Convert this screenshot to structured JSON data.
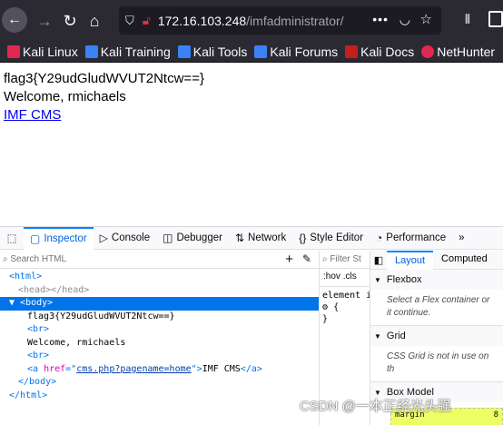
{
  "browser": {
    "url_host": "172.16.103.248",
    "url_path": "/imfadministrator/",
    "more_label": "•••"
  },
  "bookmarks": [
    {
      "label": "Kali Linux",
      "icon": "kali-icon"
    },
    {
      "label": "Kali Training",
      "icon": "kali-training-icon"
    },
    {
      "label": "Kali Tools",
      "icon": "kali-tools-icon"
    },
    {
      "label": "Kali Forums",
      "icon": "kali-forums-icon"
    },
    {
      "label": "Kali Docs",
      "icon": "kali-docs-icon"
    },
    {
      "label": "NetHunter",
      "icon": "nethunter-icon"
    }
  ],
  "page": {
    "flag": "flag3{Y29udGludWVUT2Ntcw==}",
    "welcome": "Welcome, rmichaels",
    "link": "IMF CMS"
  },
  "devtools": {
    "tabs": [
      {
        "label": "Inspector",
        "icon": "inspector-icon"
      },
      {
        "label": "Console",
        "icon": "console-icon"
      },
      {
        "label": "Debugger",
        "icon": "debugger-icon"
      },
      {
        "label": "Network",
        "icon": "network-icon"
      },
      {
        "label": "Style Editor",
        "icon": "style-editor-icon"
      },
      {
        "label": "Performance",
        "icon": "performance-icon"
      }
    ],
    "search_placeholder": "Search HTML",
    "tree": {
      "html_open": "<html>",
      "head": "<head></head>",
      "body_open": "<body>",
      "flag_text": "flag3{Y29udGludWVUT2Ntcw==}",
      "br1": "<br>",
      "welcome_text": "Welcome, rmichaels",
      "br2": "<br>",
      "a_open": "<a ",
      "a_attr": "href",
      "a_eq": "=\"",
      "a_val": "cms.php?pagename=home",
      "a_close_q": "\">",
      "a_text": "IMF CMS",
      "a_end": "</a>",
      "body_close": "</body>",
      "html_close": "</html>"
    },
    "rules": {
      "filter_placeholder": "Filter St",
      "hov": ":hov",
      "cls": ".cls",
      "element": "element i",
      "brace_open": "{",
      "brace_close": "}"
    },
    "layout": {
      "tabs": [
        "Layout",
        "Computed"
      ],
      "sections": [
        {
          "title": "Flexbox",
          "body": "Select a Flex container or it continue."
        },
        {
          "title": "Grid",
          "body": "CSS Grid is not in use on th"
        },
        {
          "title": "Box Model",
          "body": ""
        }
      ],
      "margin_label": "margin",
      "margin_value": "8"
    }
  },
  "watermark": "CSDN @一本正经光头强",
  "colors": {
    "toolbar_bg": "#2b2a33",
    "accent": "#0a84ff",
    "link": "#0000ee"
  }
}
